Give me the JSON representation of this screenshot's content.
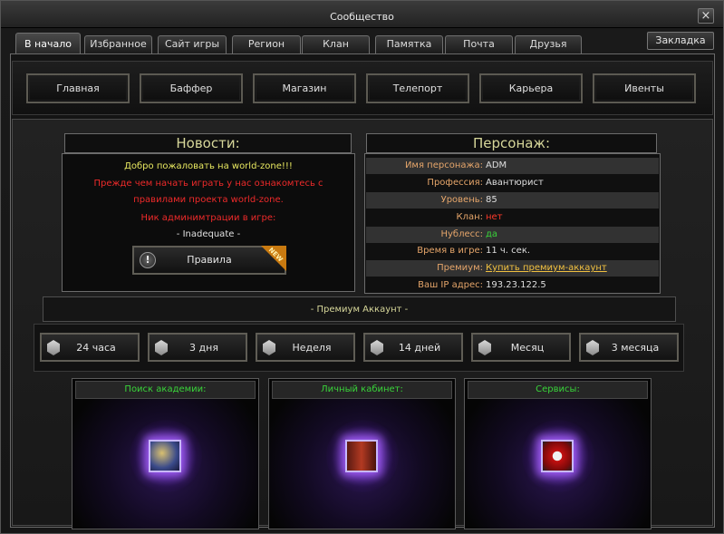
{
  "window": {
    "title": "Сообщество",
    "close_label": "×"
  },
  "tabs": [
    {
      "label": "В начало",
      "active": true
    },
    {
      "label": "Избранное"
    },
    {
      "label": "Сайт игры"
    },
    {
      "label": "Регион"
    },
    {
      "label": "Клан"
    },
    {
      "label": "Памятка"
    },
    {
      "label": "Почта"
    },
    {
      "label": "Друзья"
    }
  ],
  "bookmark_label": "Закладка",
  "menu": [
    {
      "label": "Главная"
    },
    {
      "label": "Баффер"
    },
    {
      "label": "Магазин"
    },
    {
      "label": "Телепорт"
    },
    {
      "label": "Карьера"
    },
    {
      "label": "Ивенты"
    }
  ],
  "news": {
    "title": "Новости:",
    "lines": [
      "Добро пожаловать на world-zone!!!",
      "Прежде чем начать играть у нас ознакомтесь с",
      "правилами проекта world-zone.",
      "Ник админимтрации в игре:",
      "- Inadequate -"
    ],
    "rules_button": "Правила",
    "new_badge": "NEW"
  },
  "character": {
    "title": "Персонаж:",
    "rows": [
      {
        "key": "Имя персонажа:",
        "value": "ADM"
      },
      {
        "key": "Профессия:",
        "value": "Авантюрист"
      },
      {
        "key": "Уровень:",
        "value": "85"
      },
      {
        "key": "Клан:",
        "value": "нет"
      },
      {
        "key": "Нублесс:",
        "value": "да"
      },
      {
        "key": "Время в игре:",
        "value": "11 ч. сек."
      },
      {
        "key": "Премиум:",
        "value": "Купить премиум-аккаунт"
      },
      {
        "key": "Ваш IP адрес:",
        "value": "193.23.122.5"
      }
    ]
  },
  "premium": {
    "label": "- Премиум Аккаунт -",
    "options": [
      {
        "label": "24 часа"
      },
      {
        "label": "3 дня"
      },
      {
        "label": "Неделя"
      },
      {
        "label": "14 дней"
      },
      {
        "label": "Месяц"
      },
      {
        "label": "3 месяца"
      }
    ]
  },
  "services": [
    {
      "title": "Поиск академии:",
      "icon": "academy-search-icon"
    },
    {
      "title": "Личный кабинет:",
      "icon": "personal-cabinet-icon"
    },
    {
      "title": "Сервисы:",
      "icon": "services-icon"
    }
  ],
  "colors": {
    "news_title": "#d7d79a",
    "news_welcome": "#e8e860",
    "news_warning": "#ee2a2a",
    "char_key": "#e5a56a",
    "char_value": "#dedede",
    "clan_value": "#ff3a2a",
    "noblesse_value": "#3ad23a",
    "premium_link": "#f0c040",
    "service_title": "#39d43a"
  }
}
